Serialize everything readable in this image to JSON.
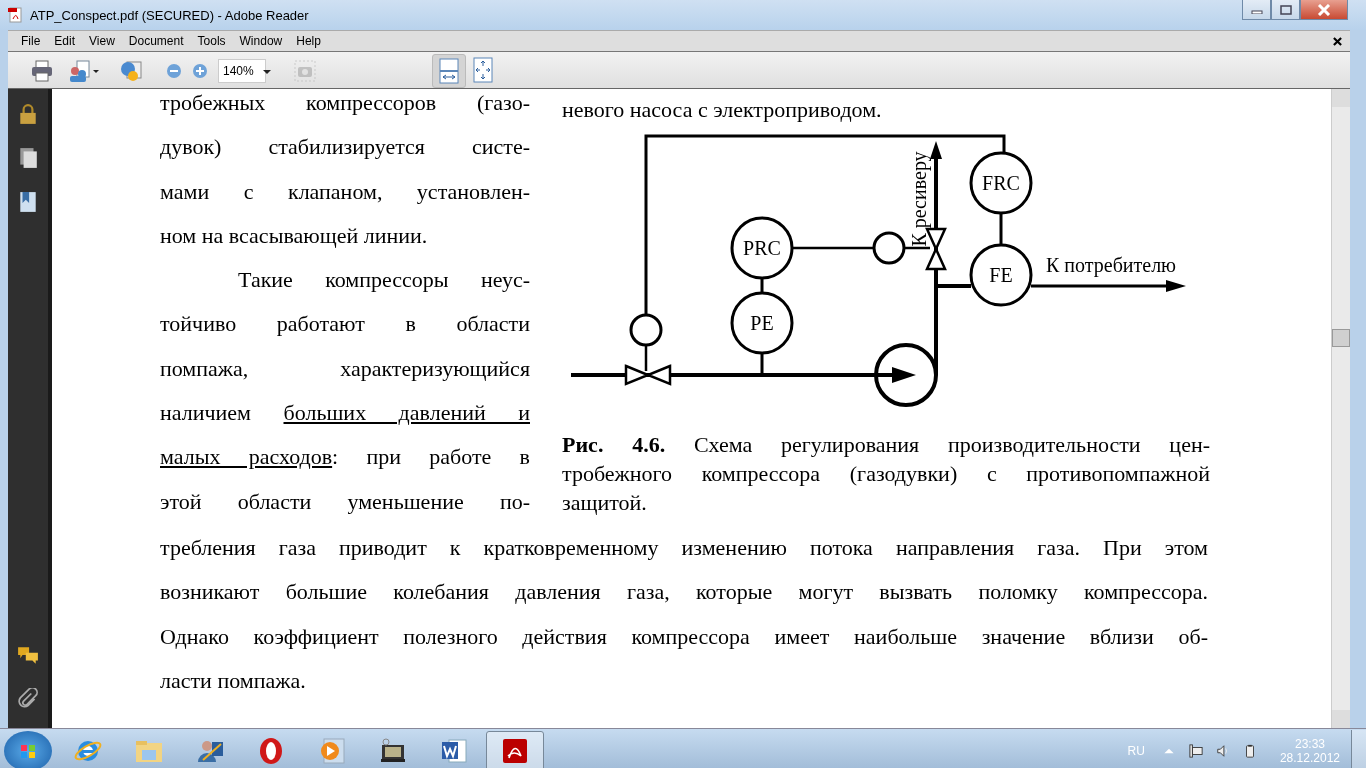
{
  "window": {
    "title": "ATP_Conspect.pdf (SECURED) - Adobe Reader"
  },
  "menu": [
    "File",
    "Edit",
    "View",
    "Document",
    "Tools",
    "Window",
    "Help"
  ],
  "toolbar": {
    "zoom": "140%",
    "snapshot_disabled": true,
    "view_buttons": [
      {
        "kind": "fit-width",
        "selected": true
      },
      {
        "kind": "fit-page",
        "selected": false
      }
    ]
  },
  "document": {
    "text_above_figure": "невого насоса с электроприводом.",
    "side_paragraphs": [
      {
        "indent": false,
        "ends_here": true,
        "lines": [
          {
            "parts": [
              {
                "text": "тробежных компрессоров (газо-",
                "underlined": false
              }
            ]
          },
          {
            "parts": [
              {
                "text": "дувок) стабилизируется систе-",
                "underlined": false
              }
            ]
          },
          {
            "parts": [
              {
                "text": "мами с клапаном, установлен-",
                "underlined": false
              }
            ]
          },
          {
            "parts": [
              {
                "text": "ном на всасывающей линии.",
                "underlined": false
              }
            ]
          }
        ]
      },
      {
        "indent": true,
        "ends_here": false,
        "lines": [
          {
            "parts": [
              {
                "text": "Такие компрессоры неус-",
                "underlined": false
              }
            ]
          },
          {
            "parts": [
              {
                "text": "тойчиво работают в области",
                "underlined": false
              }
            ]
          },
          {
            "parts": [
              {
                "text": "помпажа, характеризующийся",
                "underlined": false
              }
            ]
          },
          {
            "parts": [
              {
                "text": "наличием ",
                "underlined": false
              },
              {
                "text": "больших давлений и",
                "underlined": true
              }
            ]
          },
          {
            "parts": [
              {
                "text": "малых расходов",
                "underlined": true
              },
              {
                "text": ": при работе в",
                "underlined": false
              }
            ]
          },
          {
            "parts": [
              {
                "text": "этой области уменьшение по-",
                "underlined": false
              }
            ]
          }
        ]
      }
    ],
    "figure": {
      "instruments": [
        {
          "label": "PRC"
        },
        {
          "label": "PE"
        },
        {
          "label": "FRC"
        },
        {
          "label": "FE"
        }
      ],
      "recycle_label": "К ресиверу",
      "outlet_label": "К потребителю"
    },
    "caption_lines": [
      "**Рис. 4.6.** Схема регулирования производительности цен-",
      "тробежного компрессора (газодувки) с противопомпажной",
      "защитой."
    ],
    "bottom_lines": [
      "требления газа приводит к кратковременному изменению потока направления газа. При этом",
      "возникают большие колебания давления газа, которые могут вызвать поломку компрессора.",
      "Однако коэффициент полезного действия компрессора имеет наибольше значение вблизи об-",
      "ласти помпажа."
    ]
  },
  "taskbar": {
    "buttons": [
      {
        "kind": "ie",
        "selected": false
      },
      {
        "kind": "explorer",
        "selected": false
      },
      {
        "kind": "user",
        "selected": false
      },
      {
        "kind": "opera",
        "selected": false
      },
      {
        "kind": "media",
        "selected": false
      },
      {
        "kind": "scanner",
        "selected": false
      },
      {
        "kind": "word",
        "selected": false
      },
      {
        "kind": "reader",
        "selected": true
      }
    ],
    "language": "RU",
    "time": "23:33",
    "date": "28.12.2012"
  }
}
